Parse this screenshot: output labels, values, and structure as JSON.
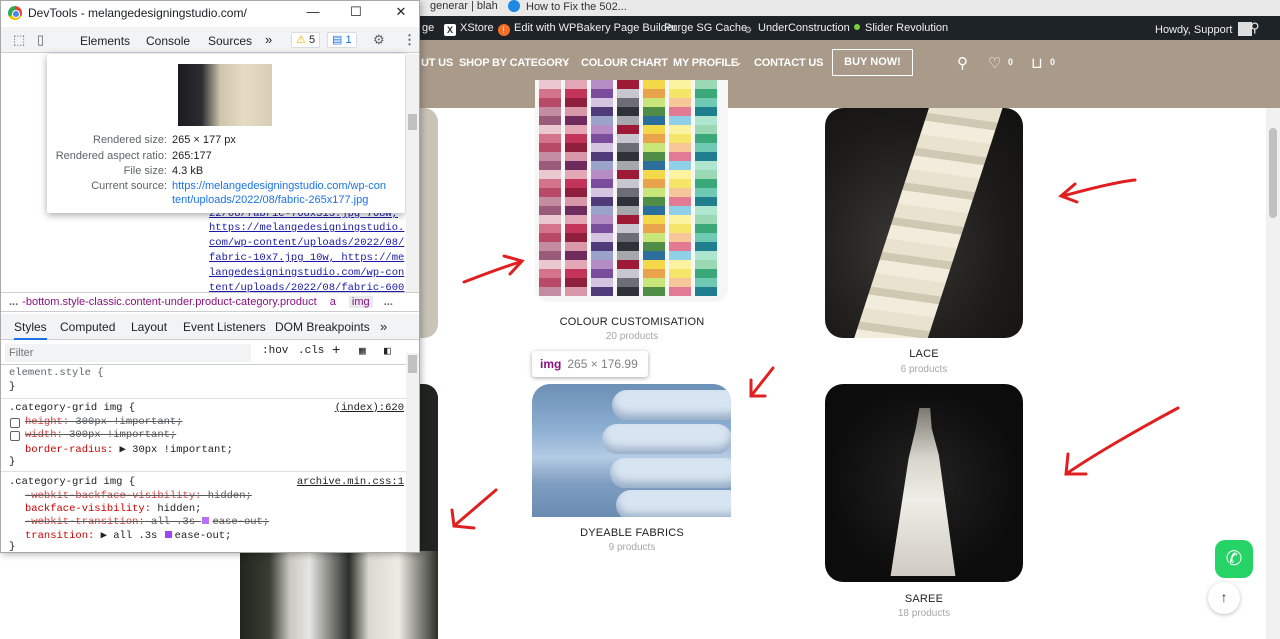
{
  "browser_bookmarks": {
    "fragment_1": "generar | blah",
    "fragment_2": "How to Fix the 502..."
  },
  "adminbar": {
    "items": [
      "ge",
      "XStore",
      "Edit with WPBakery Page Builder",
      "Purge SG Cache",
      "UnderConstruction",
      "Slider Revolution"
    ],
    "greeting": "Howdy, Support",
    "underconstruction_dot_color": "#7ad03a",
    "xstore_badge_color": "#f56e28"
  },
  "nav": {
    "items": [
      "UT US",
      "SHOP BY CATEGORY",
      "COLOUR CHART",
      "MY PROFILE",
      "CONTACT US"
    ],
    "buy_now": "BUY NOW!",
    "wishlist_count": "0",
    "cart_count": "0",
    "header_color": "#a99a8a"
  },
  "categories": [
    {
      "title": "COLOUR CUSTOMISATION",
      "count": "20 products"
    },
    {
      "title": "LACE",
      "count": "6 products"
    },
    {
      "title": "DYEABLE FABRICS",
      "count": "9 products"
    },
    {
      "title": "SAREE",
      "count": "18 products"
    }
  ],
  "img_tooltip": {
    "tag": "img",
    "dims": "265 × 176.99"
  },
  "annotation_color": "#e02020",
  "devtools": {
    "window_title": "DevTools - melangedesigningstudio.com/",
    "tabs": [
      "Elements",
      "Console",
      "Sources"
    ],
    "more_tabs": "»",
    "warnings": "5",
    "messages": "1",
    "hover_card": {
      "rendered_size_label": "Rendered size:",
      "rendered_size": "265 × 177 px",
      "aspect_label": "Rendered aspect ratio:",
      "aspect": "265:177",
      "file_size_label": "File size:",
      "file_size": "4.3 kB",
      "source_label": "Current source:",
      "source_line1": "https://melangedesigningstudio.com/wp-con",
      "source_line2": "tent/uploads/2022/08/fabric-265x177.jpg"
    },
    "elements_lines": [
      "22/08/fabric-768x513.jpg 768w,",
      "https://melangedesigningstudio.",
      "com/wp-content/uploads/2022/08/",
      "fabric-10x7.jpg 10w, https://me",
      "langedesigningstudio.com/wp-con",
      "tent/uploads/2022/08/fabric-600"
    ],
    "breadcrumb": {
      "lead": "...",
      "path": "-bottom.style-classic.content-under.product-category.product",
      "a": "a",
      "img": "img",
      "trail": "..."
    },
    "subtabs": [
      "Styles",
      "Computed",
      "Layout",
      "Event Listeners",
      "DOM Breakpoints"
    ],
    "subtabs_more": "»",
    "filter_placeholder": "Filter",
    "filter_buttons": [
      ":hov",
      ".cls",
      "+"
    ],
    "styles": {
      "element_style": "element.style {",
      "close": "}",
      "rule1_selector": ".category-grid img {",
      "rule1_source": "(index):620",
      "rule1_decls": [
        {
          "prop": "height:",
          "val": " 300px !important;"
        },
        {
          "prop": "width:",
          "val": " 300px !important;"
        },
        {
          "prop": "border-radius:",
          "val": " ▶ 30px !important;"
        }
      ],
      "rule2_selector": ".category-grid img {",
      "rule2_source": "archive.min.css:1",
      "rule2_decls": [
        {
          "prop": "-webkit-backface-visibility:",
          "val": " hidden;"
        },
        {
          "prop": "backface-visibility:",
          "val": " hidden;"
        },
        {
          "prop": "-webkit-transition:",
          "val": " all .3s "
        },
        {
          "prop": "transition:",
          "val": " ▶ all .3s "
        }
      ],
      "ease_out": "ease-out;"
    }
  }
}
